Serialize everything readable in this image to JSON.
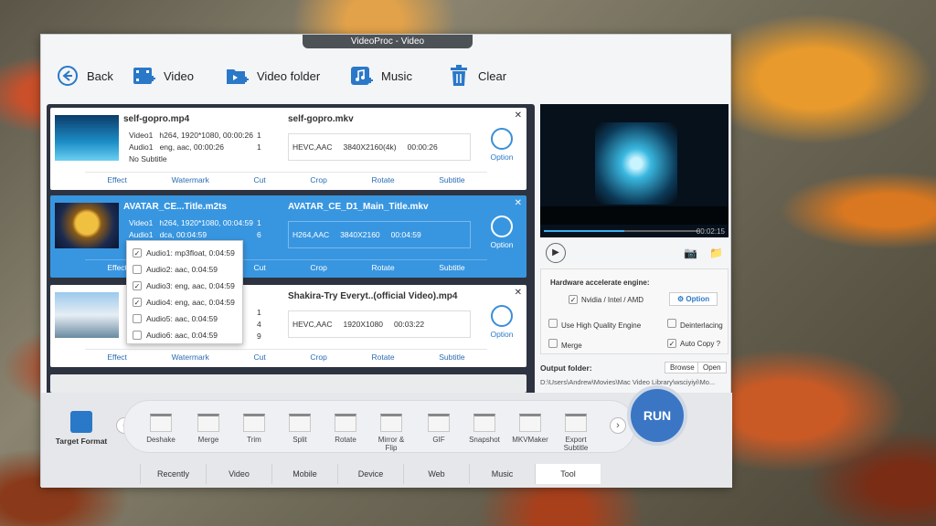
{
  "window": {
    "title": "VideoProc - Video"
  },
  "toolbar": {
    "back": "Back",
    "video": "Video",
    "video_folder": "Video folder",
    "music": "Music",
    "clear": "Clear"
  },
  "items": [
    {
      "name": "self-gopro.mp4",
      "video": "Video1",
      "video_info": "h264, 1920*1080, 00:00:26",
      "audio": "Audio1",
      "audio_info": "eng, aac, 00:00:26",
      "subtitle": "No Subtitle",
      "n1": "1",
      "n2": "1",
      "out": "self-gopro.mkv",
      "codec": "HEVC,AAC",
      "res": "3840X2160(4k)",
      "dur": "00:00:26",
      "opt": "Option"
    },
    {
      "name": "AVATAR_CE...Title.m2ts",
      "video": "Video1",
      "video_info": "h264, 1920*1080, 00:04:59",
      "audio": "Audio1",
      "audio_info": "dca, 00:04:59",
      "subtitle": "",
      "n1": "1",
      "n2": "6",
      "out": "AVATAR_CE_D1_Main_Title.mkv",
      "codec": "H264,AAC",
      "res": "3840X2160",
      "dur": "00:04:59",
      "opt": "Option"
    },
    {
      "name": "",
      "video": "",
      "video_info": "",
      "audio": "",
      "audio_info": "",
      "subtitle": "",
      "n1": "1",
      "n2": "4",
      "n3": "9",
      "out": "Shakira-Try Everyt..(official Video).mp4",
      "codec": "HEVC,AAC",
      "res": "1920X1080",
      "dur": "00:03:22",
      "opt": "Option"
    }
  ],
  "actions": {
    "effect": "Effect",
    "watermark": "Watermark",
    "cut": "Cut",
    "crop": "Crop",
    "rotate": "Rotate",
    "subtitle": "Subtitle"
  },
  "audio_dropdown": [
    {
      "label": "Audio1: mp3float, 0:04:59",
      "checked": true
    },
    {
      "label": "Audio2: aac, 0:04:59",
      "checked": false
    },
    {
      "label": "Audio3: eng, aac, 0:04:59",
      "checked": true
    },
    {
      "label": "Audio4: eng, aac, 0:04:59",
      "checked": true
    },
    {
      "label": "Audio5: aac, 0:04:59",
      "checked": false
    },
    {
      "label": "Audio6: aac, 0:04:59",
      "checked": false
    }
  ],
  "preview": {
    "time": "00:02:15"
  },
  "settings": {
    "hw_title": "Hardware accelerate engine:",
    "hw_value": "Nvidia / Intel / AMD",
    "option": "Option",
    "hq": "Use High Quality Engine",
    "deinterlace": "Deinterlacing",
    "merge": "Merge",
    "autocopy": "Auto Copy"
  },
  "output": {
    "label": "Output folder:",
    "browse": "Browse",
    "open": "Open",
    "path": "D:\\Users\\Andrew\\Movies\\Mac Video Library\\wsciyiyi\\Mo..."
  },
  "tools": {
    "target_format": "Target Format",
    "items": [
      "Deshake",
      "Merge",
      "Trim",
      "Split",
      "Rotate",
      "Mirror & Flip",
      "GIF",
      "Snapshot",
      "MKVMaker",
      "Export Subtitle"
    ]
  },
  "tabs": [
    "Recently",
    "Video",
    "Mobile",
    "Device",
    "Web",
    "Music",
    "Tool"
  ],
  "run": "RUN",
  "colors": {
    "accent": "#3896e0",
    "list_bg": "#2d3340",
    "run": "#3a76c4"
  }
}
